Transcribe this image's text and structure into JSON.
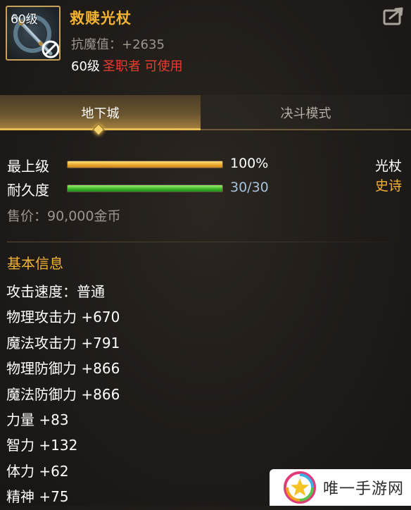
{
  "item": {
    "level_badge": "60级",
    "name": "救赎光杖",
    "stat_line": "抗魔值：+2635",
    "req_level": "60级",
    "req_class": "圣职者 可使用",
    "weapon_type": "光杖",
    "rarity": "史诗",
    "rarity_color": "#f2b233"
  },
  "tabs": [
    {
      "label": "地下城",
      "active": true
    },
    {
      "label": "决斗模式",
      "active": false
    }
  ],
  "bars": {
    "upgrade": {
      "label": "最上级",
      "value_text": "100%",
      "fraction": 1.0
    },
    "durability": {
      "label": "耐久度",
      "value_text": "30/30",
      "fraction": 1.0
    }
  },
  "price": "售价：90,000金币",
  "basic_info": {
    "title": "基本信息",
    "attributes": [
      "攻击速度：普通",
      "物理攻击力 +670",
      "魔法攻击力 +791",
      "物理防御力 +866",
      "魔法防御力 +866",
      "力量 +83",
      "智力 +132",
      "体力 +62",
      "精神 +75"
    ]
  },
  "watermark": {
    "text": "唯一手游网"
  },
  "icons": [
    "staff-icon",
    "no-entry-icon",
    "share-icon",
    "diamond-indicator-icon",
    "star-logo-icon"
  ],
  "colors": {
    "gold": "#f2b233",
    "red": "#ef3b2f",
    "bar_gold": "#e7a52a",
    "bar_green": "#39b52a"
  }
}
